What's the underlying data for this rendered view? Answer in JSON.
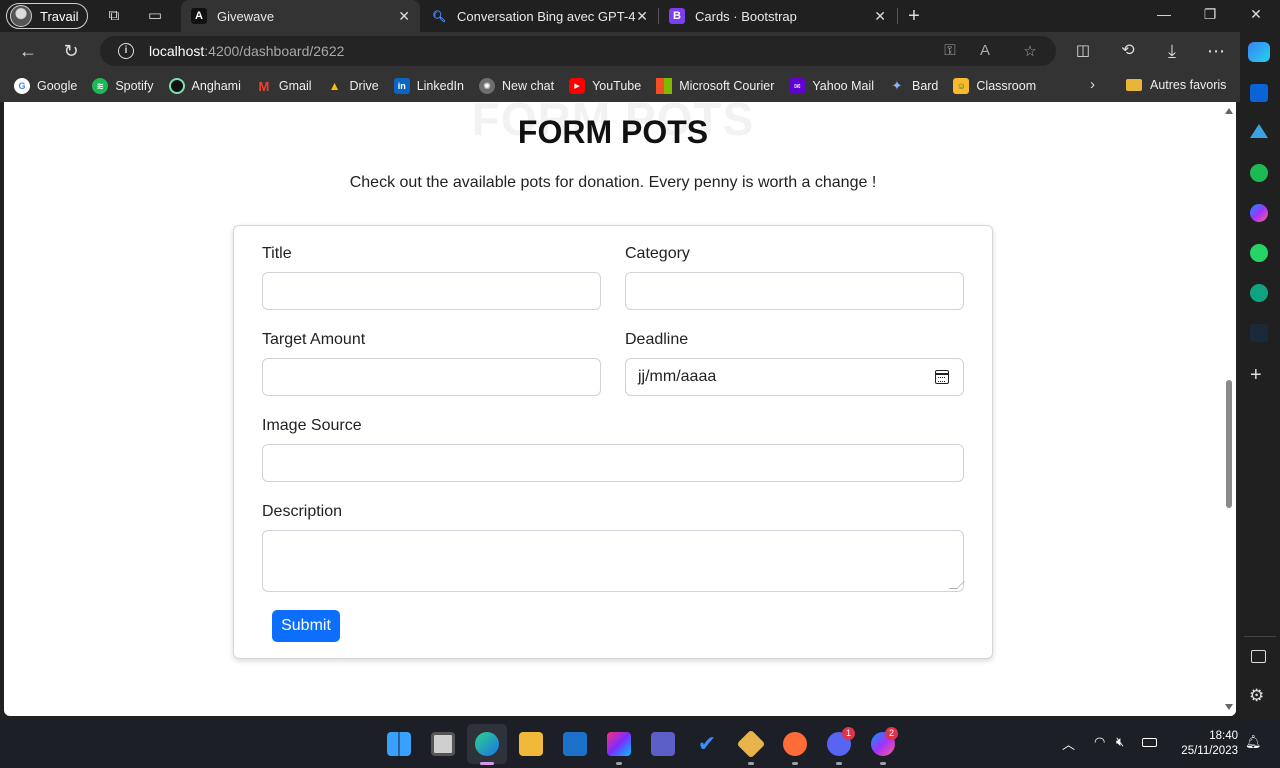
{
  "browser": {
    "profile_name": "Travail",
    "tabs": [
      {
        "label": "Givewave",
        "active": true
      },
      {
        "label": "Conversation Bing avec GPT-4",
        "active": false
      },
      {
        "label": "Cards · Bootstrap",
        "active": false
      }
    ],
    "url_host": "localhost",
    "url_path": ":4200/dashboard/2622",
    "bookmarks": [
      "Google",
      "Spotify",
      "Anghami",
      "Gmail",
      "Drive",
      "LinkedIn",
      "New chat",
      "YouTube",
      "Microsoft Courier",
      "Yahoo Mail",
      "Bard",
      "Classroom"
    ],
    "other_bookmarks": "Autres favoris"
  },
  "page": {
    "ghost_title": "FORM POTS",
    "title": "FORM POTS",
    "subtitle": "Check out the available pots for donation. Every penny is worth a change !",
    "form": {
      "title_label": "Title",
      "title_value": "",
      "category_label": "Category",
      "category_value": "",
      "target_label": "Target Amount",
      "target_value": "",
      "deadline_label": "Deadline",
      "deadline_placeholder": "jj/mm/aaaa",
      "image_label": "Image Source",
      "image_value": "",
      "description_label": "Description",
      "description_value": "",
      "submit_label": "Submit"
    }
  },
  "taskbar": {
    "time": "18:40",
    "date": "25/11/2023",
    "discord_badge": "1",
    "messenger_badge": "2"
  },
  "colors": {
    "accent": "#0d6efd",
    "tab_active": "#333333",
    "chrome_bg": "#202020"
  }
}
